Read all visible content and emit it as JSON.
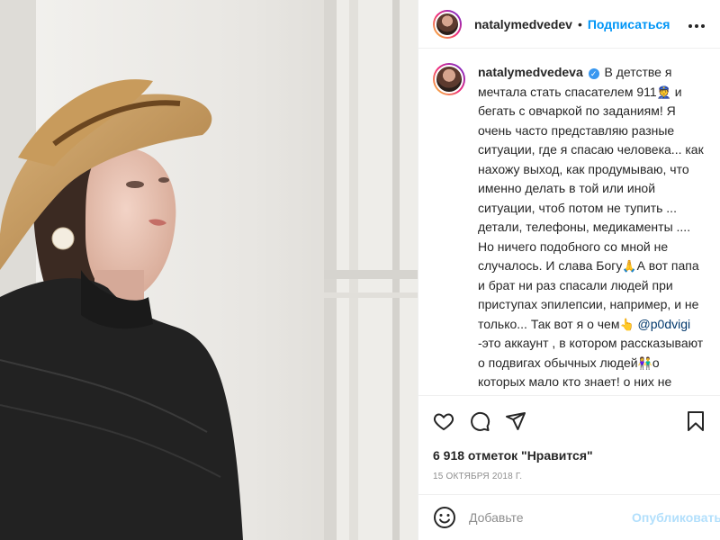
{
  "post": {
    "username": "natalymedvedev",
    "dot": "•",
    "follow_label": "Подписаться",
    "more_icon": "more-horizontal-icon",
    "image_alt": "Woman in straw hat looking out a window"
  },
  "caption": {
    "username": "natalymedvedeva",
    "verified": "✓",
    "text_1": "В детстве я мечтала стать спасателем 911",
    "emoji_1": "👮",
    "text_2": "и бегать с овчаркой по заданиям! Я очень часто представляю разные ситуации, где я спасаю человека... как нахожу выход, как продумываю, что именно делать в той или иной ситуации, чтоб потом не тупить ... детали, телефоны, медикаменты .... Но ничего подобного со мной не случалось. И слава Богу",
    "emoji_2": "🙏",
    "text_3": "А вот папа и брат ни раз спасали людей при приступах эпилепсии, например, и не только... Так вот я о чем",
    "emoji_3": "👆",
    "mention": "@p0dvigi",
    "text_4": " -это аккаунт , в котором рассказывают о подвигах обычных людей",
    "emoji_4": "👫",
    "text_5": "о которых мало кто знает! о них не говорят в новостях, не приглашают в программы, не"
  },
  "actions": {
    "like_icon": "heart-icon",
    "comment_icon": "comment-icon",
    "share_icon": "share-icon",
    "save_icon": "bookmark-icon",
    "likes": "6 918 отметок \"Нравится\"",
    "date": "15 октября 2018 г."
  },
  "comment_box": {
    "emoji_icon": "smile-icon",
    "placeholder": "Добавьте",
    "publish_label": "Опубликовать"
  }
}
